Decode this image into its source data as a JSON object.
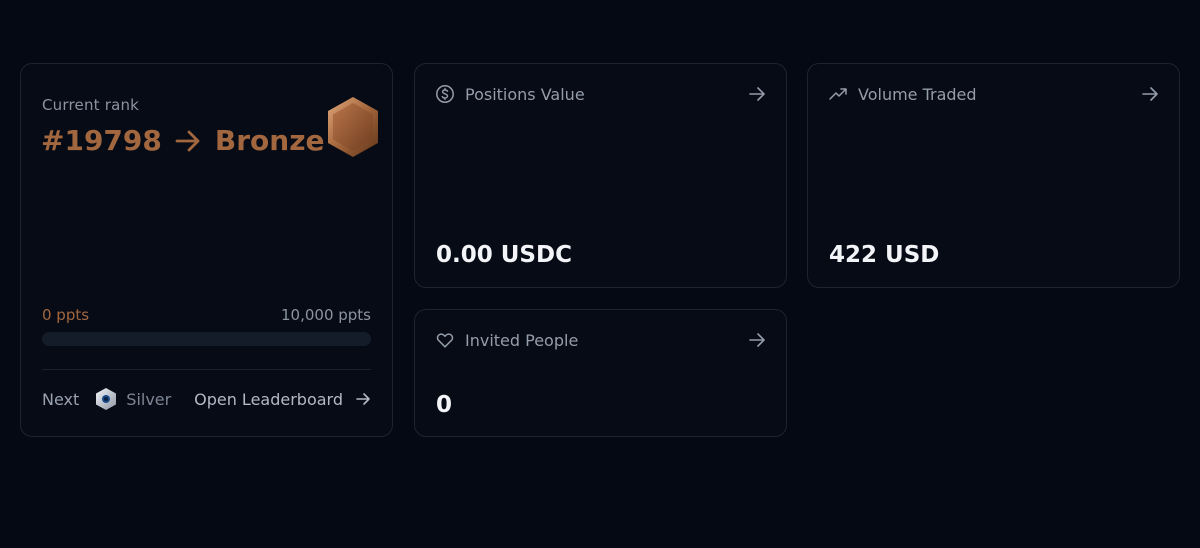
{
  "rank_card": {
    "label": "Current rank",
    "rank_number": "#19798",
    "tier": "Bronze",
    "current_points": "0 ppts",
    "target_points": "10,000 ppts",
    "progress": 0,
    "next_label": "Next",
    "next_tier": "Silver",
    "leaderboard_link": "Open Leaderboard",
    "accent_color": "#a2673f"
  },
  "positions_card": {
    "title": "Positions Value",
    "value": "0.00 USDC",
    "icon": "dollar-circle-icon"
  },
  "volume_card": {
    "title": "Volume Traded",
    "value": "422 USD",
    "icon": "trending-up-icon"
  },
  "invited_card": {
    "title": "Invited People",
    "value": "0",
    "icon": "heart-icon"
  }
}
